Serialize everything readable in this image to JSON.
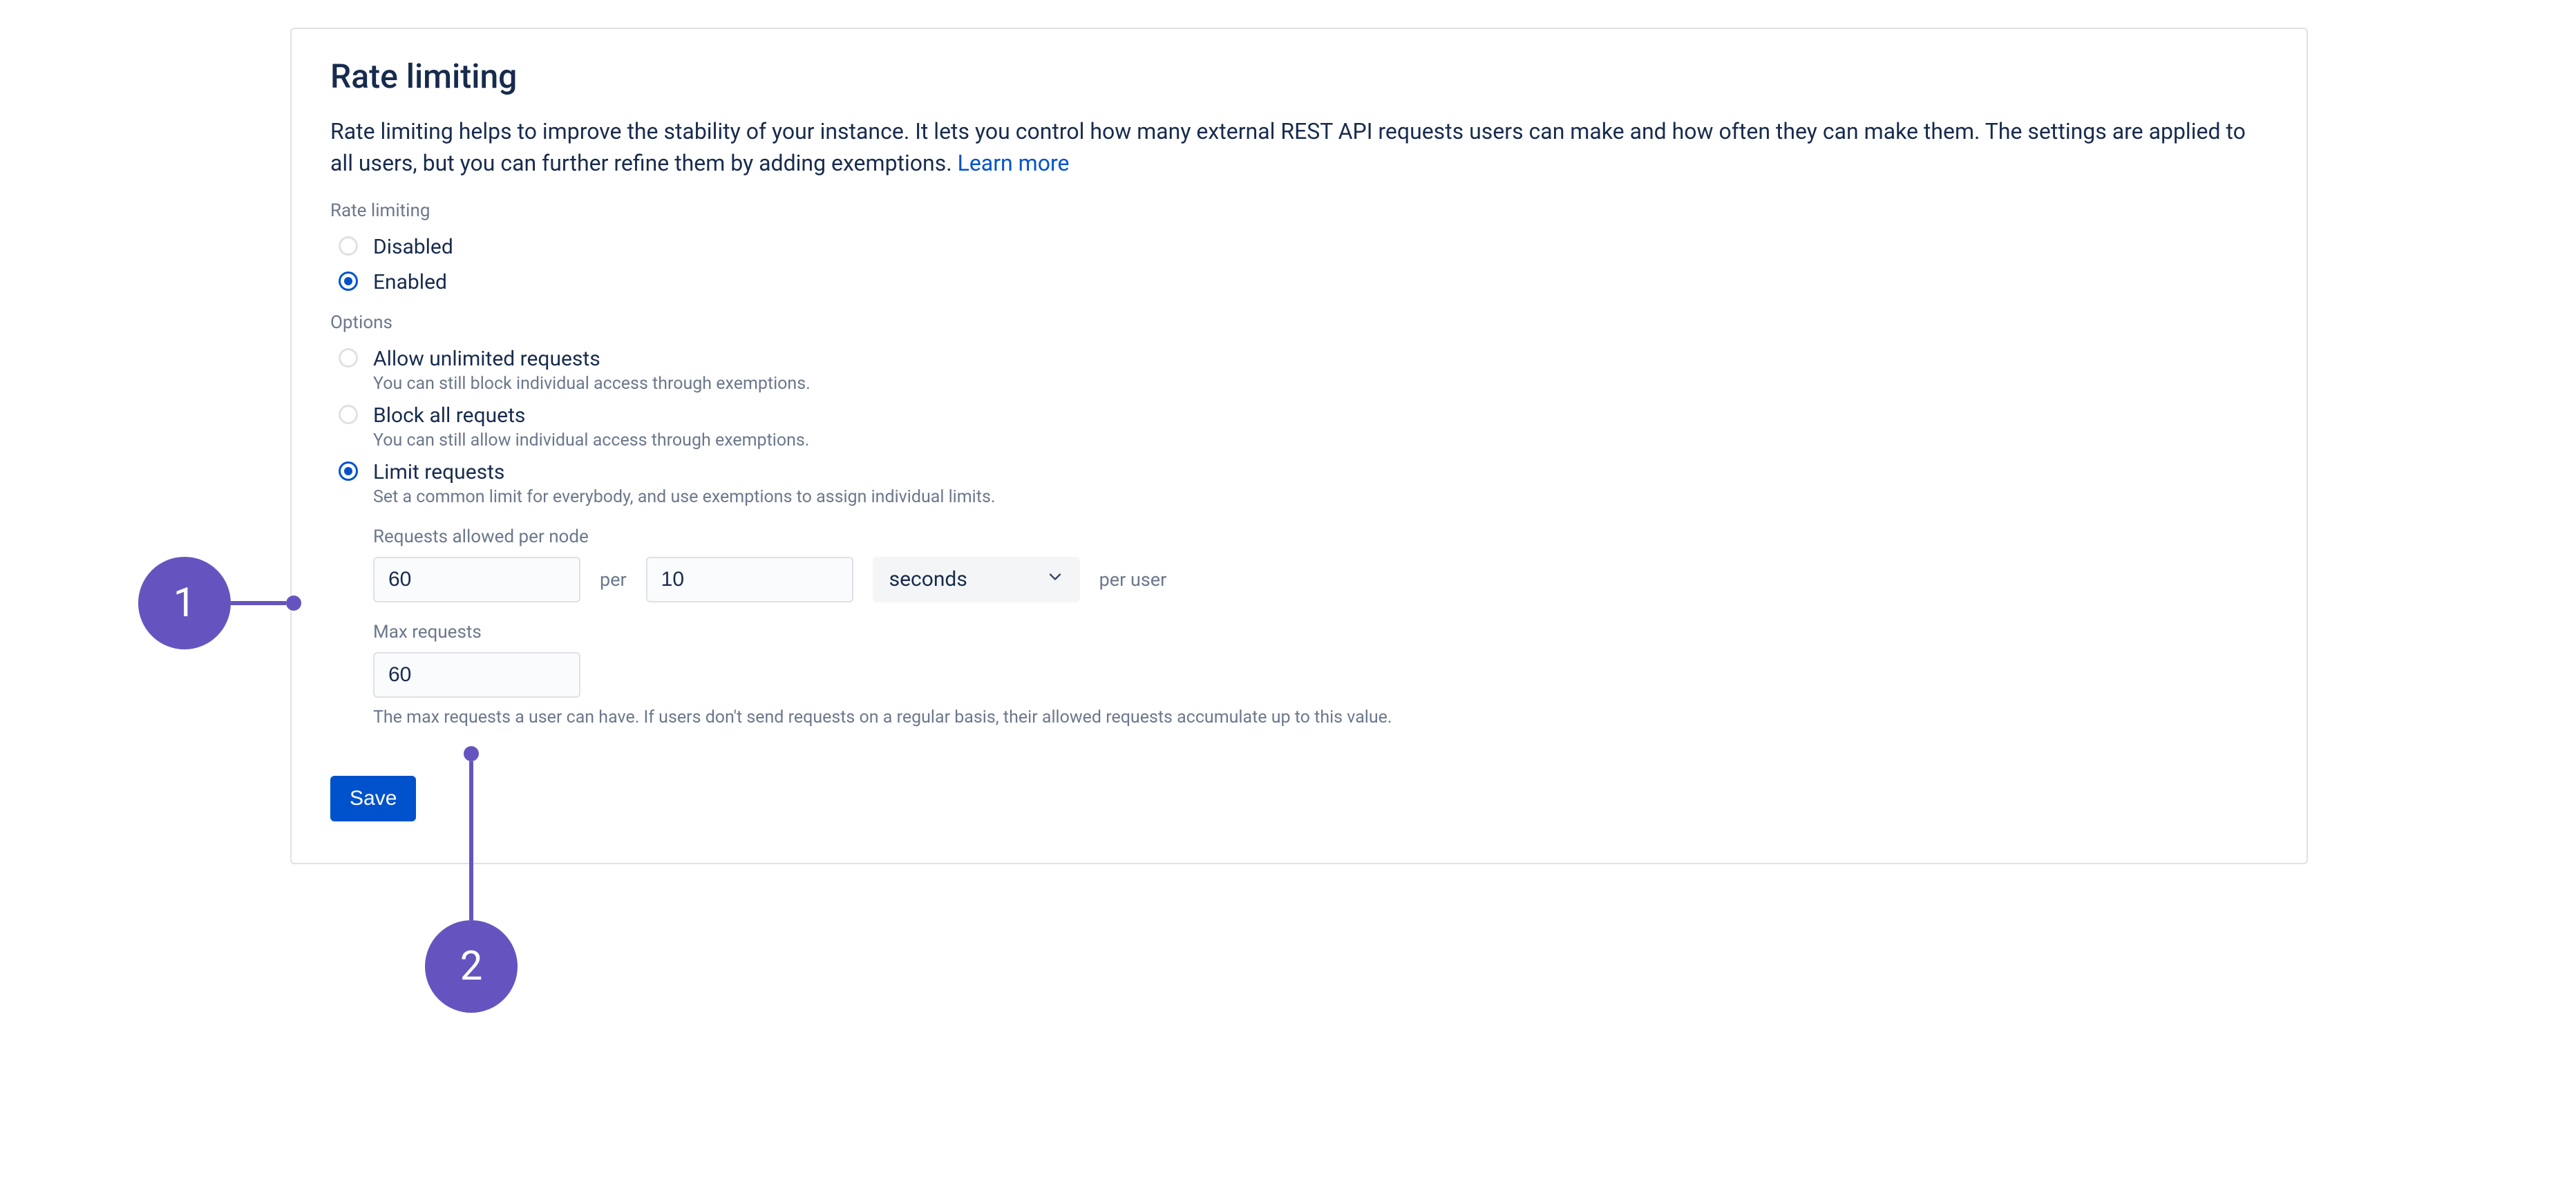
{
  "page": {
    "title": "Rate limiting",
    "description": "Rate limiting helps to improve the stability of your instance. It lets you control how many external REST API requests users can make and how often they can make them. The settings are applied to all users, but you can further refine them by adding exemptions. ",
    "learn_more": "Learn more"
  },
  "sections": {
    "rate_limiting_label": "Rate limiting",
    "options_label": "Options"
  },
  "status_radios": {
    "disabled": "Disabled",
    "enabled": "Enabled"
  },
  "option_radios": {
    "unlimited": {
      "label": "Allow unlimited requests",
      "helper": "You can still block individual access through exemptions."
    },
    "block_all": {
      "label": "Block all requets",
      "helper": "You can still allow individual access through exemptions."
    },
    "limit": {
      "label": "Limit requests",
      "helper": "Set a common limit for everybody, and use exemptions to assign individual limits."
    }
  },
  "fields": {
    "requests_allowed_label": "Requests allowed per node",
    "requests_value": "60",
    "per_text": "per",
    "interval_value": "10",
    "unit_value": "seconds",
    "per_user_text": "per user",
    "max_requests_label": "Max requests",
    "max_requests_value": "60",
    "max_requests_help": "The max requests a user can have. If users don't send requests on a regular basis, their allowed requests accumulate up to this value."
  },
  "buttons": {
    "save": "Save"
  },
  "callouts": {
    "one": "1",
    "two": "2"
  }
}
